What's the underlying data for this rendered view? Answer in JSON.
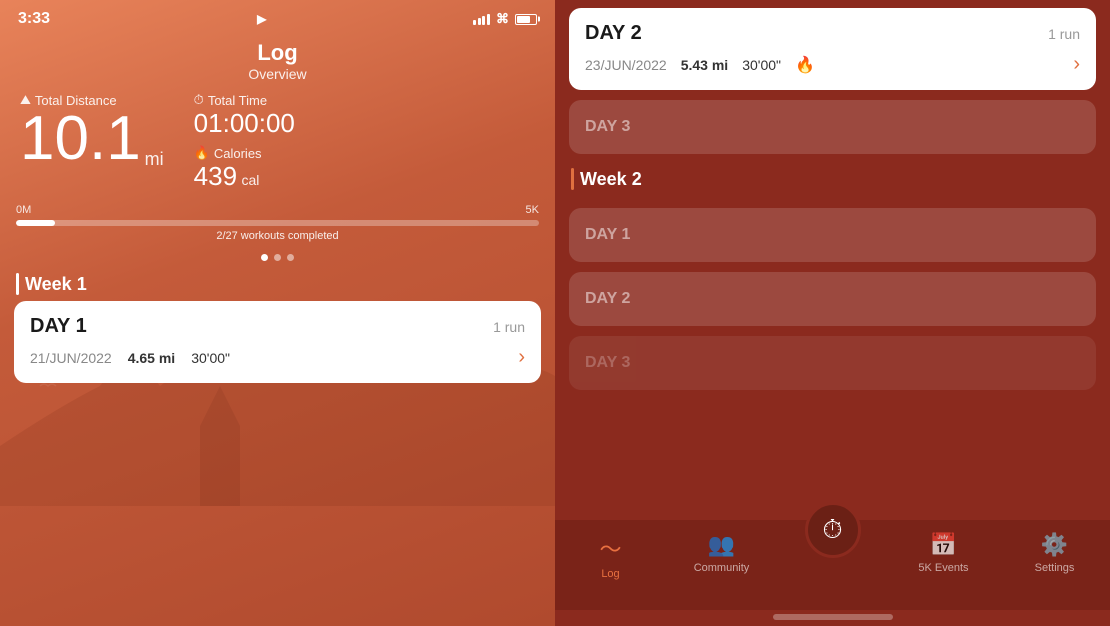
{
  "statusBar": {
    "time": "3:33",
    "locationArrow": "▶"
  },
  "leftPanel": {
    "title": "Log",
    "subtitle": "Overview",
    "totalDistanceLabel": "Total Distance",
    "totalTimeLabel": "Total Time",
    "distanceValue": "10.1",
    "distanceUnit": "mi",
    "timeValue": "01:00:00",
    "caloriesLabel": "Calories",
    "caloriesValue": "439",
    "caloriesUnit": "cal",
    "progressStart": "0M",
    "progressWorkouts": "2/27 workouts completed",
    "progressEnd": "5K",
    "week1Label": "Week 1",
    "day1Title": "DAY 1",
    "day1Runs": "1 run",
    "day1Date": "21/JUN/2022",
    "day1Distance": "4.65 mi",
    "day1Time": "30'00\""
  },
  "rightPanel": {
    "day2Title": "DAY 2",
    "day2Runs": "1 run",
    "day2Date": "23/JUN/2022",
    "day2Distance": "5.43 mi",
    "day2Time": "30'00\"",
    "day3Title": "DAY 3",
    "week2Label": "Week 2",
    "week2Day1Title": "DAY 1",
    "week2Day2Title": "DAY 2"
  },
  "tabBar": {
    "logLabel": "Log",
    "communityLabel": "Community",
    "timerLabel": "",
    "eventsLabel": "5K Events",
    "settingsLabel": "Settings"
  }
}
